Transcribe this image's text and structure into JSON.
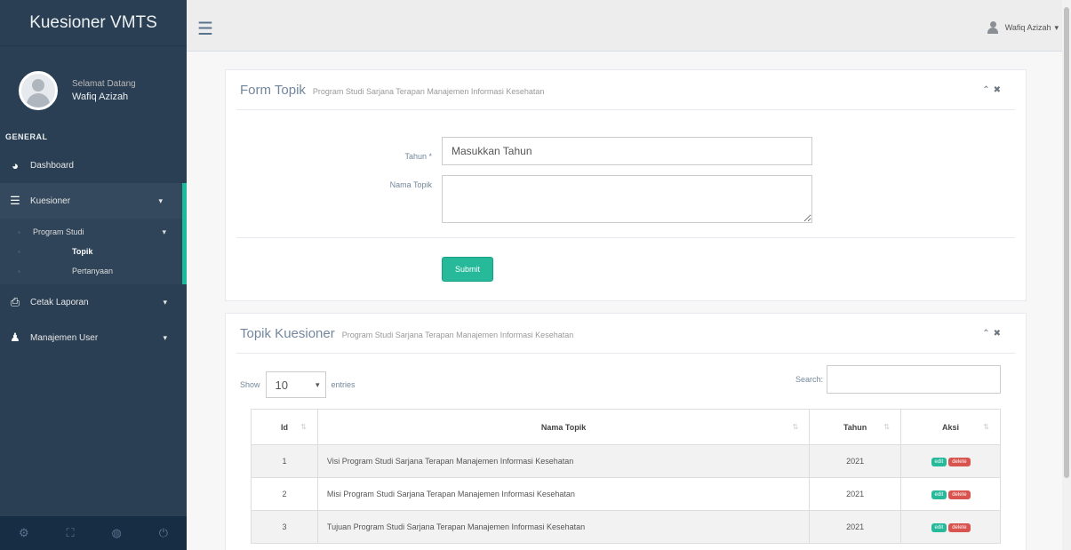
{
  "brand": "Kuesioner VMTS",
  "profile": {
    "welcome": "Selamat Datang",
    "name": "Wafiq Azizah"
  },
  "sidebar": {
    "section": "GENERAL",
    "items": [
      {
        "label": "Dashboard",
        "icon": "dashboard-icon"
      },
      {
        "label": "Kuesioner",
        "icon": "table-icon"
      },
      {
        "label": "Cetak Laporan",
        "icon": "print-icon"
      },
      {
        "label": "Manajemen User",
        "icon": "user-icon"
      }
    ],
    "submenu": {
      "label": "Program Studi",
      "children": [
        "Topik",
        "Pertanyaan"
      ]
    }
  },
  "topbar": {
    "user": "Wafiq Azizah"
  },
  "form_panel": {
    "title": "Form Topik",
    "subtitle": "Program Studi Sarjana Terapan Manajemen Informasi Kesehatan",
    "tahun_label": "Tahun *",
    "tahun_placeholder": "Masukkan Tahun",
    "nama_label": "Nama Topik",
    "submit": "Submit"
  },
  "table_panel": {
    "title": "Topik Kuesioner",
    "subtitle": "Program Studi Sarjana Terapan Manajemen Informasi Kesehatan",
    "show": "Show",
    "entries_value": "10",
    "entries": "entries",
    "search": "Search:",
    "columns": [
      "Id",
      "Nama Topik",
      "Tahun",
      "Aksi"
    ],
    "edit_label": "edit",
    "delete_label": "delete",
    "rows": [
      {
        "id": "1",
        "nama": "Visi Program Studi Sarjana Terapan Manajemen Informasi Kesehatan",
        "tahun": "2021"
      },
      {
        "id": "2",
        "nama": "Misi Program Studi Sarjana Terapan Manajemen Informasi Kesehatan",
        "tahun": "2021"
      },
      {
        "id": "3",
        "nama": "Tujuan Program Studi Sarjana Terapan Manajemen Informasi Kesehatan",
        "tahun": "2021"
      }
    ]
  }
}
